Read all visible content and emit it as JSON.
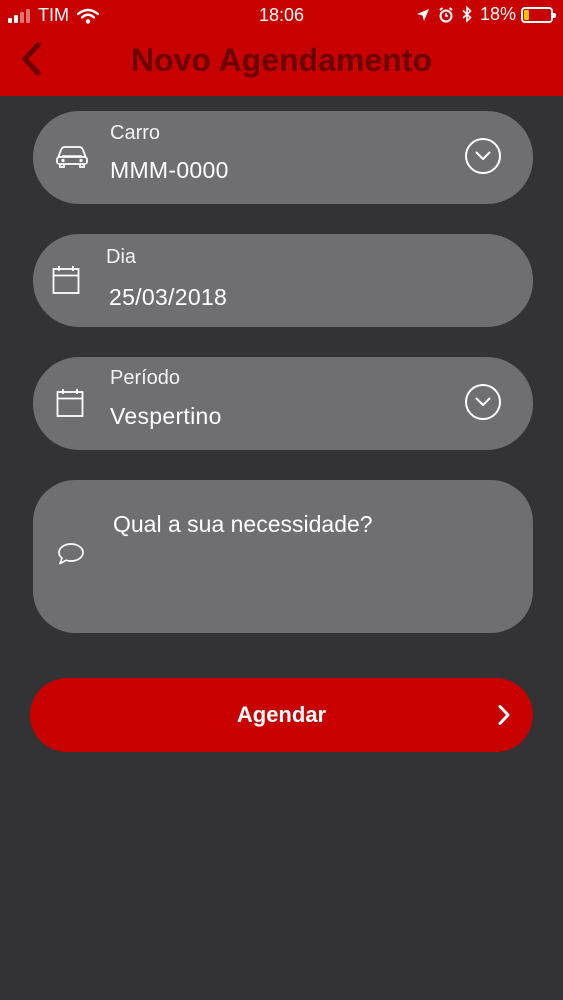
{
  "status_bar": {
    "carrier": "TIM",
    "time": "18:06",
    "battery": "18%",
    "battery_level": 0.18,
    "icons": [
      "signal-icon",
      "wifi-icon",
      "location-arrow-icon",
      "alarm-icon",
      "bluetooth-icon",
      "battery-icon"
    ]
  },
  "header": {
    "title": "Novo Agendamento",
    "back_icon": "chevron-left-icon",
    "background_color": "#c90000",
    "title_color": "#6b0000"
  },
  "form": {
    "car": {
      "label": "Carro",
      "value": "MMM-0000",
      "icon": "car-icon",
      "action_icon": "chevron-down-circle-icon"
    },
    "day": {
      "label": "Dia",
      "value": "25/03/2018",
      "icon": "calendar-icon"
    },
    "period": {
      "label": "Período",
      "value": "Vespertino",
      "icon": "calendar-icon",
      "action_icon": "chevron-down-circle-icon"
    },
    "need": {
      "placeholder": "Qual a sua necessidade?",
      "icon": "speech-bubble-icon"
    }
  },
  "submit": {
    "label": "Agendar",
    "icon": "chevron-right-icon",
    "color": "#c90000"
  },
  "colors": {
    "background": "#333235",
    "field": "#6f6e72",
    "accent": "#c90000"
  }
}
